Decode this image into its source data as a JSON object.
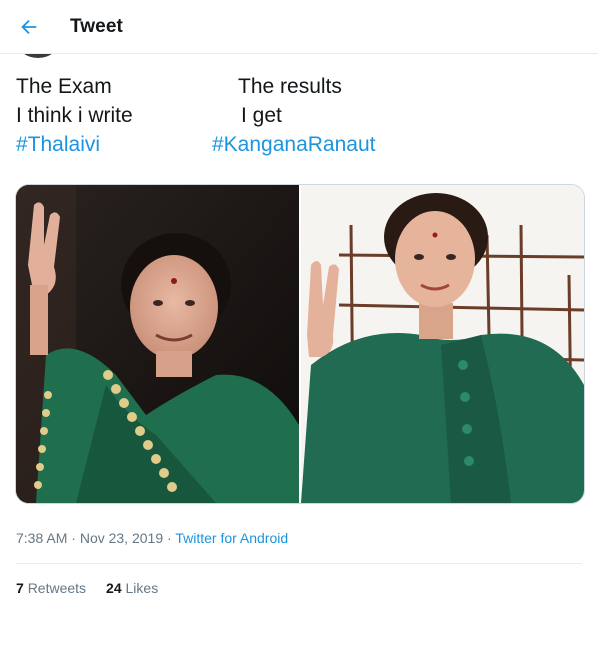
{
  "header": {
    "title": "Tweet",
    "back_icon": "arrow-left-icon",
    "accent_color": "#1b95e0"
  },
  "tweet": {
    "lines": [
      {
        "left": "The Exam",
        "right": "The results"
      },
      {
        "left": "I think i write",
        "right": "I get"
      },
      {
        "left": "#Thalaivi",
        "right": "#KanganaRanaut"
      }
    ],
    "media": [
      {
        "description": "photo-left"
      },
      {
        "description": "photo-right"
      }
    ]
  },
  "meta": {
    "time": "7:38 AM",
    "separator1": " · ",
    "date": "Nov 23, 2019",
    "separator2": " · ",
    "source": "Twitter for Android"
  },
  "stats": {
    "retweets_count": "7",
    "retweets_label": "Retweets",
    "likes_count": "24",
    "likes_label": "Likes"
  }
}
